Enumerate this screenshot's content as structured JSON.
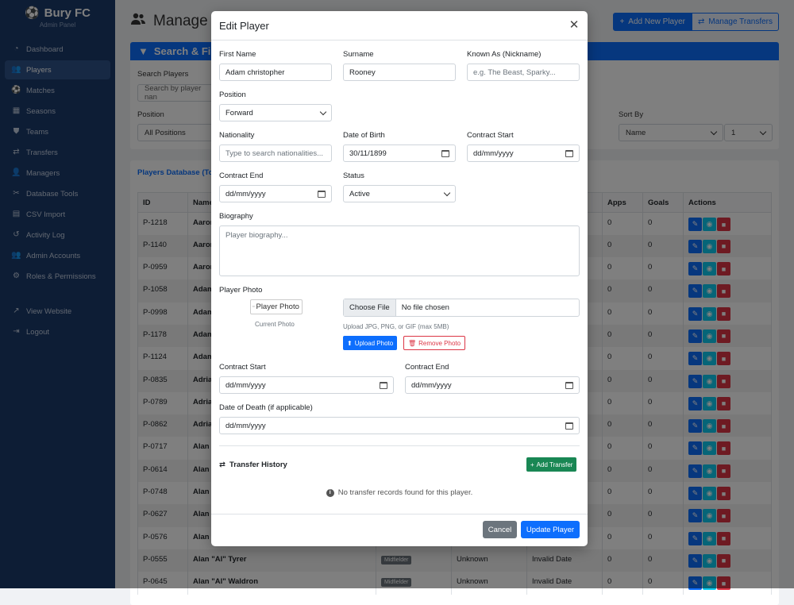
{
  "app": {
    "title": "Bury FC",
    "subtitle": "Admin Panel"
  },
  "sidebar": {
    "items": [
      {
        "label": "Dashboard",
        "icon": "dashboard-icon"
      },
      {
        "label": "Players",
        "icon": "players-icon",
        "active": true
      },
      {
        "label": "Matches",
        "icon": "ball-icon"
      },
      {
        "label": "Seasons",
        "icon": "calendar-icon"
      },
      {
        "label": "Teams",
        "icon": "shield-icon"
      },
      {
        "label": "Transfers",
        "icon": "transfer-icon"
      },
      {
        "label": "Managers",
        "icon": "user-icon"
      },
      {
        "label": "Database Tools",
        "icon": "tools-icon"
      },
      {
        "label": "CSV Import",
        "icon": "file-icon"
      },
      {
        "label": "Activity Log",
        "icon": "history-icon"
      },
      {
        "label": "Admin Accounts",
        "icon": "users-icon"
      },
      {
        "label": "Roles & Permissions",
        "icon": "roles-icon"
      }
    ],
    "bottom": [
      {
        "label": "View Website",
        "icon": "external-link-icon"
      },
      {
        "label": "Logout",
        "icon": "logout-icon"
      }
    ]
  },
  "header": {
    "title": "Manage P",
    "add_player": "Add New Player",
    "manage_transfers": "Manage Transfers"
  },
  "filters": {
    "title": "Search & Filte",
    "search_label": "Search Players",
    "search_placeholder": "Search by player nan",
    "position_label": "Position",
    "position_value": "All Positions",
    "sort_label": "Sort By",
    "sort_value": "Name",
    "sort_dir_value": "1"
  },
  "database": {
    "title": "Players Database (Tot",
    "columns": {
      "id": "ID",
      "name": "Name",
      "apps": "Apps",
      "goals": "Goals",
      "actions": "Actions"
    },
    "rows": [
      {
        "id": "P-1218",
        "name": "Aaron",
        "position": "",
        "status": "",
        "dob": "",
        "apps": "0",
        "goals": "0"
      },
      {
        "id": "P-1140",
        "name": "Aaron",
        "position": "",
        "status": "",
        "dob": "",
        "apps": "0",
        "goals": "0"
      },
      {
        "id": "P-0959",
        "name": "Aaron",
        "position": "",
        "status": "",
        "dob": "",
        "apps": "0",
        "goals": "0"
      },
      {
        "id": "P-1058",
        "name": "Adam",
        "position": "",
        "status": "",
        "dob": "",
        "apps": "0",
        "goals": "0"
      },
      {
        "id": "P-0998",
        "name": "Adam",
        "position": "",
        "status": "",
        "dob": "",
        "apps": "0",
        "goals": "0"
      },
      {
        "id": "P-1178",
        "name": "Adam",
        "position": "",
        "status": "",
        "dob": "",
        "apps": "0",
        "goals": "0"
      },
      {
        "id": "P-1124",
        "name": "Adam",
        "position": "",
        "status": "",
        "dob": "",
        "apps": "0",
        "goals": "0"
      },
      {
        "id": "P-0835",
        "name": "Adria",
        "position": "",
        "status": "",
        "dob": "",
        "apps": "0",
        "goals": "0"
      },
      {
        "id": "P-0789",
        "name": "Adria",
        "position": "",
        "status": "",
        "dob": "",
        "apps": "0",
        "goals": "0"
      },
      {
        "id": "P-0862",
        "name": "Adria",
        "position": "",
        "status": "",
        "dob": "",
        "apps": "0",
        "goals": "0"
      },
      {
        "id": "P-0717",
        "name": "Alan",
        "position": "",
        "status": "",
        "dob": "",
        "apps": "0",
        "goals": "0"
      },
      {
        "id": "P-0614",
        "name": "Alan",
        "position": "",
        "status": "",
        "dob": "",
        "apps": "0",
        "goals": "0"
      },
      {
        "id": "P-0748",
        "name": "Alan",
        "position": "",
        "status": "",
        "dob": "",
        "apps": "0",
        "goals": "0"
      },
      {
        "id": "P-0627",
        "name": "Alan",
        "position": "",
        "status": "",
        "dob": "",
        "apps": "0",
        "goals": "0"
      },
      {
        "id": "P-0576",
        "name": "Alan",
        "position": "",
        "status": "",
        "dob": "",
        "apps": "0",
        "goals": "0"
      },
      {
        "id": "P-0555",
        "name": "Alan \"Al\" Tyrer",
        "position": "Midfielder",
        "status": "Unknown",
        "dob": "Invalid Date",
        "apps": "0",
        "goals": "0"
      },
      {
        "id": "P-0645",
        "name": "Alan \"Al\" Waldron",
        "position": "Midfielder",
        "status": "Unknown",
        "dob": "Invalid Date",
        "apps": "0",
        "goals": "0"
      }
    ]
  },
  "modal": {
    "title": "Edit Player",
    "first_name": {
      "label": "First Name",
      "value": "Adam christopher"
    },
    "surname": {
      "label": "Surname",
      "value": "Rooney"
    },
    "known_as": {
      "label": "Known As (Nickname)",
      "placeholder": "e.g. The Beast, Sparky..."
    },
    "position": {
      "label": "Position",
      "value": "Forward"
    },
    "nationality": {
      "label": "Nationality",
      "placeholder": "Type to search nationalities..."
    },
    "dob": {
      "label": "Date of Birth",
      "value": "30/11/1899"
    },
    "contract_start": {
      "label": "Contract Start",
      "placeholder": "dd/mm/yyyy"
    },
    "contract_end": {
      "label": "Contract End",
      "placeholder": "dd/mm/yyyy"
    },
    "status": {
      "label": "Status",
      "value": "Active"
    },
    "biography": {
      "label": "Biography",
      "placeholder": "Player biography..."
    },
    "photo": {
      "label": "Player Photo",
      "alt": "Player Photo",
      "caption": "Current Photo",
      "choose_file": "Choose File",
      "no_file": "No file chosen",
      "hint": "Upload JPG, PNG, or GIF (max 5MB)",
      "upload": "Upload Photo",
      "remove": "Remove Photo"
    },
    "contract_start2": {
      "label": "Contract Start",
      "placeholder": "dd/mm/yyyy"
    },
    "contract_end2": {
      "label": "Contract End",
      "placeholder": "dd/mm/yyyy"
    },
    "death": {
      "label": "Date of Death (if applicable)",
      "placeholder": "dd/mm/yyyy"
    },
    "transfer_title": "Transfer History",
    "add_transfer": "Add Transfer",
    "no_transfers": "No transfer records found for this player.",
    "cancel": "Cancel",
    "update": "Update Player"
  }
}
